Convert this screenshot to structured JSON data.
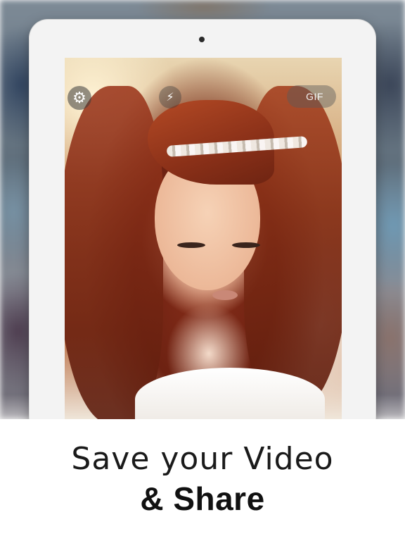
{
  "camera_ui": {
    "settings_icon": "gear-icon",
    "settings_glyph": "⚙",
    "flash_icon": "flash-off-icon",
    "flash_glyph": "⚡",
    "gif_label": "GIF"
  },
  "caption": {
    "line1": "Save your Video",
    "line2": "& Share"
  },
  "colors": {
    "device_frame": "#f3f3f3",
    "caption_text": "#1a1a1a",
    "overlay_button": "#3c3c3c"
  }
}
